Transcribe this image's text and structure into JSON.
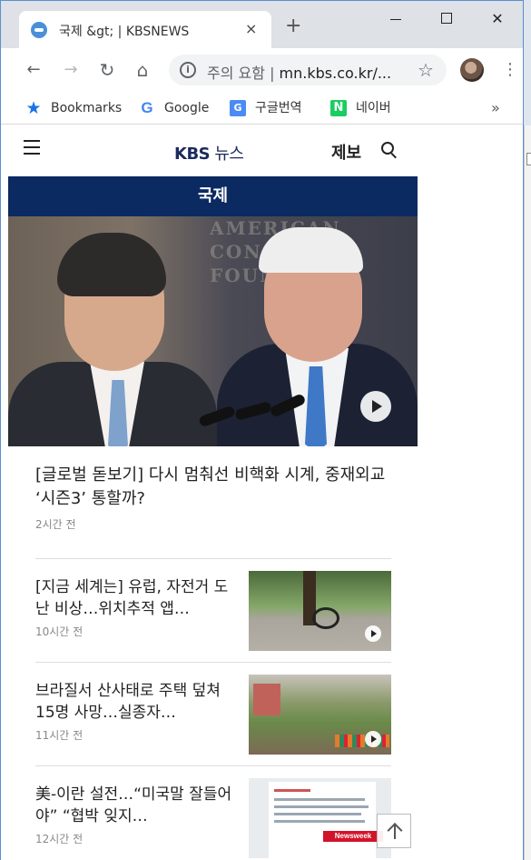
{
  "browser": {
    "tab_title": "국제 &gt; | KBSNEWS",
    "tab_close": "×",
    "new_tab": "+",
    "window_close": "✕",
    "url_warning": "주의 요함",
    "url_separator": "|",
    "url": "mn.kbs.co.kr/...",
    "omnibox_info": "i",
    "nav": {
      "back": "←",
      "forward": "→",
      "reload": "↻",
      "home": "⌂",
      "star": "☆",
      "menu": "⋮"
    },
    "bookmarks": [
      {
        "label": "Bookmarks",
        "icon": "star-icon",
        "glyph": "★"
      },
      {
        "label": "Google",
        "icon": "google-icon",
        "glyph": "G"
      },
      {
        "label": "구글번역",
        "icon": "translate-icon",
        "glyph": "G"
      },
      {
        "label": "네이버",
        "icon": "naver-icon",
        "glyph": "N"
      }
    ],
    "bookmarks_more": "»"
  },
  "site": {
    "logo_kbs": "KBS",
    "logo_news": " 뉴스",
    "report_label": "제보",
    "section_title": "국제",
    "hero_bg_text": [
      "AMERICAN",
      "CONSERVA",
      "FOUNDATI"
    ],
    "lead": {
      "title": "[글로벌 돋보기] 다시 멈춰선 비핵화 시계, 중재외교 ‘시즌3’ 통할까?",
      "time": "2시간 전"
    },
    "items": [
      {
        "title": "[지금 세계는] 유럽, 자전거 도난 비상…위치추적 앱…",
        "time": "10시간 전"
      },
      {
        "title": "브라질서 산사태로 주택 덮쳐 15명 사망…실종자…",
        "time": "11시간 전"
      },
      {
        "title": "美-이란 설전…“미국말 잘들어야” “협박 잊지…",
        "time": "12시간 전"
      }
    ],
    "thumb3_badge": "Newsweek"
  },
  "colors": {
    "section_bar": "#0b2a62",
    "logo": "#1b2a5e"
  }
}
